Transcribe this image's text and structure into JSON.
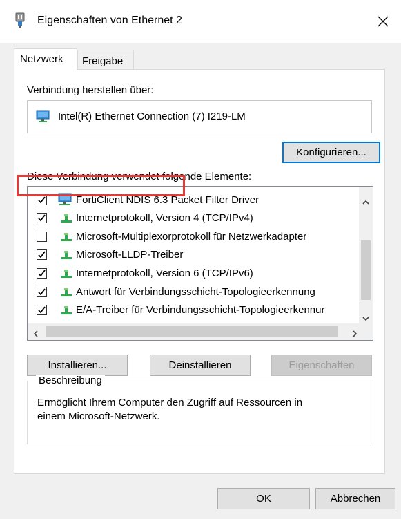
{
  "window": {
    "title": "Eigenschaften von Ethernet 2",
    "close_icon": "close-icon"
  },
  "tabs": [
    {
      "label": "Netzwerk",
      "active": true
    },
    {
      "label": "Freigabe",
      "active": false
    }
  ],
  "connection": {
    "label": "Verbindung herstellen über:",
    "adapter_name": "Intel(R) Ethernet Connection (7) I219-LM",
    "configure_label": "Konfigurieren..."
  },
  "components": {
    "label": "Diese Verbindung verwendet folgende Elemente:",
    "items": [
      {
        "label": "FortiClient NDIS 6.3 Packet Filter Driver",
        "checked": true,
        "icon": "network-adapter-icon"
      },
      {
        "label": "Internetprotokoll, Version 4 (TCP/IPv4)",
        "checked": true,
        "icon": "protocol-icon"
      },
      {
        "label": "Microsoft-Multiplexorprotokoll für Netzwerkadapter",
        "checked": false,
        "icon": "protocol-icon"
      },
      {
        "label": "Microsoft-LLDP-Treiber",
        "checked": true,
        "icon": "protocol-icon"
      },
      {
        "label": "Internetprotokoll, Version 6 (TCP/IPv6)",
        "checked": true,
        "icon": "protocol-icon"
      },
      {
        "label": "Antwort für Verbindungsschicht-Topologieerkennung",
        "checked": true,
        "icon": "protocol-icon"
      },
      {
        "label": "E/A-Treiber für Verbindungsschicht-Topologieerkennur",
        "checked": true,
        "icon": "protocol-icon"
      }
    ],
    "selected_index": 3
  },
  "actions": {
    "install_label": "Installieren...",
    "uninstall_label": "Deinstallieren",
    "properties_label": "Eigenschaften"
  },
  "description": {
    "legend": "Beschreibung",
    "line1": "Ermöglicht Ihrem Computer den Zugriff auf Ressourcen in",
    "line2": "einem Microsoft-Netzwerk."
  },
  "footer": {
    "ok_label": "OK",
    "cancel_label": "Abbrechen"
  },
  "colors": {
    "accent": "#0078d7",
    "highlight": "#e53935"
  }
}
